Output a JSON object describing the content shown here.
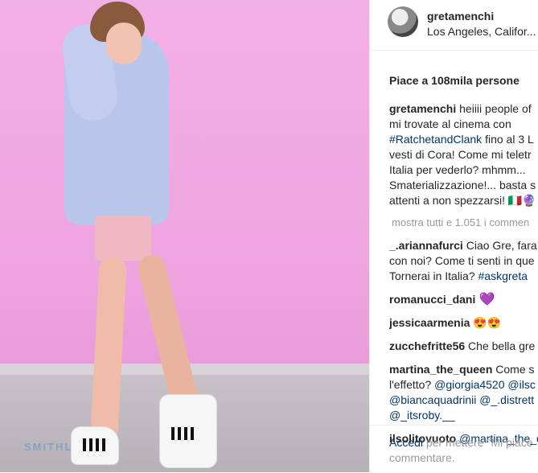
{
  "post": {
    "username": "gretamenchi",
    "location": "Los Angeles, Califor...",
    "likes": "Piace a 108mila persone",
    "stencil_text": "SMITHL"
  },
  "caption": {
    "user": "gretamenchi",
    "line1": "heiiii people of",
    "line2": "mi trovate al cinema con",
    "hashtag": "#RatchetandClank",
    "line3_rest": " fino al 3 L",
    "line4": "vesti di Cora! Come mi teletr",
    "line5": "Italia per vederlo? mhmm...",
    "line6": "Smaterializzazione!... basta s",
    "line7": "attenti a non spezzarsi! 🇮🇹🔮"
  },
  "show_all": "mostra tutti e 1.051 i commen",
  "comments": [
    {
      "user": "_.ariannafurci",
      "text1": " Ciao Gre, fara",
      "text2": "con noi? Come ti senti in que",
      "text3": "Tornerai in Italia? ",
      "tag": "#askgreta"
    },
    {
      "user": "romanucci_dani",
      "text": " 💜"
    },
    {
      "user": "jessicaarmenia",
      "text": " 😍😍"
    },
    {
      "user": "zucchefritte56",
      "text": " Che bella gre"
    },
    {
      "user": "martina_the_queen",
      "text1": " Come s",
      "text2a": "l'effetto? ",
      "mention1": "@giorgia4520",
      "mention2": " @ilsc",
      "mention3": "@biancaquadrinii",
      "mention4": " @_.distrett",
      "mention5": "@_itsroby.__"
    },
    {
      "user": "ilsolitovuoto",
      "mention": " @martina_the_q"
    }
  ],
  "footer": {
    "login_link": "Accedi",
    "login_text": " per mettere \"Mi piace",
    "login_text2": "commentare."
  }
}
